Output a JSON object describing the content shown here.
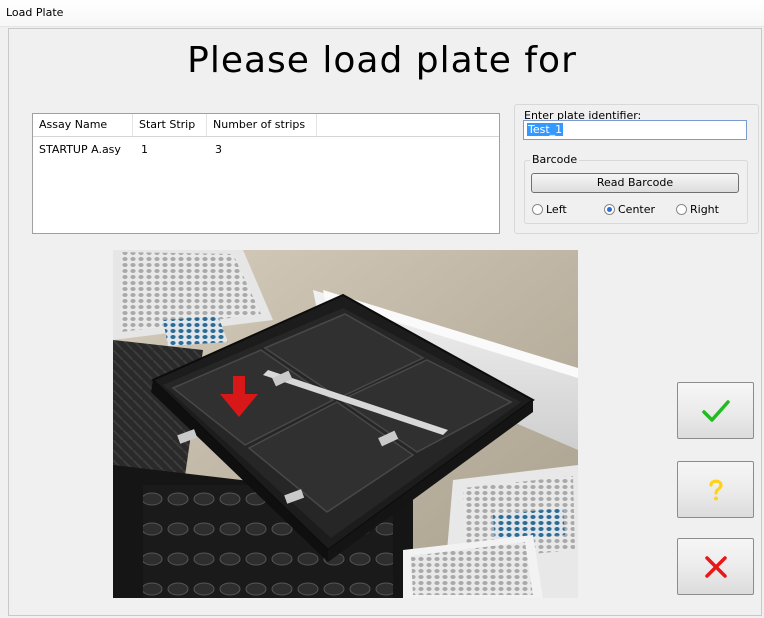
{
  "window": {
    "title": "Load Plate"
  },
  "headline": "Please load plate for",
  "table": {
    "columns": [
      "Assay Name",
      "Start Strip",
      "Number of strips"
    ],
    "rows": [
      {
        "assay": "STARTUP A.asy",
        "start": "1",
        "count": "3"
      }
    ]
  },
  "plate_identifier": {
    "label": "Enter plate identifier:",
    "value": "Test_1"
  },
  "barcode": {
    "group_label": "Barcode",
    "read_label": "Read Barcode",
    "options": {
      "left": "Left",
      "center": "Center",
      "right": "Right"
    },
    "selected": "Center"
  },
  "side_buttons": {
    "ok_icon": "checkmark-icon",
    "help_icon": "question-icon",
    "cancel_icon": "close-icon"
  },
  "colors": {
    "ok": "#22bb22",
    "help": "#ffd21a",
    "cancel": "#e81818",
    "arrow": "#d81818"
  }
}
